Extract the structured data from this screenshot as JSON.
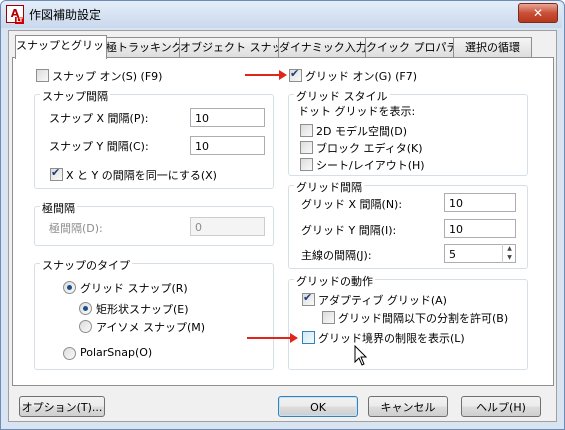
{
  "window": {
    "title": "作図補助設定",
    "app_icon_letter": "A",
    "app_icon_sub": "LT",
    "close_glyph": "✕"
  },
  "tabs": [
    {
      "label": "スナップとグリッド",
      "active": true
    },
    {
      "label": "極トラッキング"
    },
    {
      "label": "オブジェクト スナップ"
    },
    {
      "label": "ダイナミック入力"
    },
    {
      "label": "クイック プロパティ"
    },
    {
      "label": "選択の循環"
    }
  ],
  "snap": {
    "on_label": "スナップ オン(S) (F9)",
    "on_checked": false,
    "spacing_group": "スナップ間隔",
    "x_label": "スナップ X 間隔(P):",
    "x_value": "10",
    "y_label": "スナップ Y 間隔(C):",
    "y_value": "10",
    "equal_label": "X と Y の間隔を同一にする(X)",
    "equal_checked": true
  },
  "polar": {
    "group": "極間隔",
    "distance_label": "極間隔(D):",
    "distance_value": "0"
  },
  "snap_type": {
    "group": "スナップのタイプ",
    "grid_snap_label": "グリッド スナップ(R)",
    "rect_label": "矩形状スナップ(E)",
    "iso_label": "アイソメ スナップ(M)",
    "polar_label": "PolarSnap(O)"
  },
  "grid": {
    "on_label": "グリッド オン(G) (F7)",
    "on_checked": true,
    "style_group": "グリッド スタイル",
    "dot_display_label": "ドット グリッドを表示:",
    "model_label": "2D モデル空間(D)",
    "block_label": "ブロック エディタ(K)",
    "sheet_label": "シート/レイアウト(H)",
    "spacing_group": "グリッド間隔",
    "x_label": "グリッド X 間隔(N):",
    "x_value": "10",
    "y_label": "グリッド Y 間隔(I):",
    "y_value": "10",
    "major_label": "主線の間隔(J):",
    "major_value": "5",
    "behavior_group": "グリッドの動作",
    "adaptive_label": "アダプティブ グリッド(A)",
    "adaptive_checked": true,
    "subdivide_label": "グリッド間隔以下の分割を許可(B)",
    "limits_label": "グリッド境界の制限を表示(L)"
  },
  "buttons": {
    "options": "オプション(T)...",
    "ok": "OK",
    "cancel": "キャンセル",
    "help": "ヘルプ(H)"
  },
  "colors": {
    "annotation_arrow": "#e0251b",
    "titlebar": "#c9d8ec",
    "close_button": "#c85036"
  }
}
